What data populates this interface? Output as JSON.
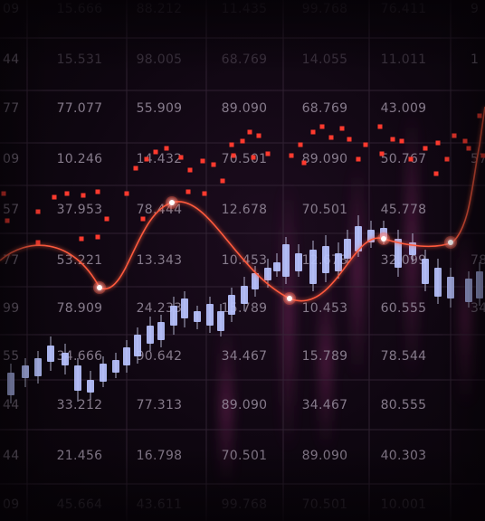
{
  "image": {
    "subject": "financial-candlestick-chart-background",
    "colors": {
      "background": "#0b050c",
      "grid": "#3a2a3c",
      "number_text": "#9a8fa0",
      "candle": "#b9c3ff",
      "candle_wick": "#c8cbe8",
      "curve": "#ff5a3c",
      "dots": "#ff3a2e",
      "glow": "#a0307a"
    },
    "number_rows": [
      [
        "15.531",
        "98.005",
        "68.769",
        "14.055",
        "11.011"
      ],
      [
        "77.077",
        "55.909",
        "89.090",
        "68.769",
        "43.009"
      ],
      [
        "10.246",
        "14.432",
        "70.501",
        "89.090",
        "50.767"
      ],
      [
        "37.953",
        "78.444",
        "12.678",
        "70.501",
        "45.778"
      ],
      [
        "53.221",
        "13.343",
        "10.453",
        "12.678",
        "32.099"
      ],
      [
        "78.909",
        "24.233",
        "15.789",
        "10.453",
        "60.555"
      ],
      [
        "34.666",
        "90.642",
        "34.467",
        "15.789",
        "78.544"
      ],
      [
        "33.212",
        "77.313",
        "89.090",
        "34.467",
        "80.555"
      ],
      [
        "21.456",
        "16.798",
        "70.501",
        "89.090",
        "40.303"
      ],
      [
        "45.664",
        "43.611",
        "99.768",
        "70.501",
        "10.001"
      ]
    ],
    "top_faded_row": [
      "15.666",
      "88.212",
      "11.435",
      "99.768",
      "76.411"
    ],
    "edge_left_fragments": [
      "09",
      "77",
      "09",
      "57",
      "77",
      "99",
      "55",
      "44",
      "44",
      "09",
      "44"
    ],
    "edge_right_fragments": [
      "9",
      "1",
      "57",
      "78",
      "34"
    ]
  }
}
